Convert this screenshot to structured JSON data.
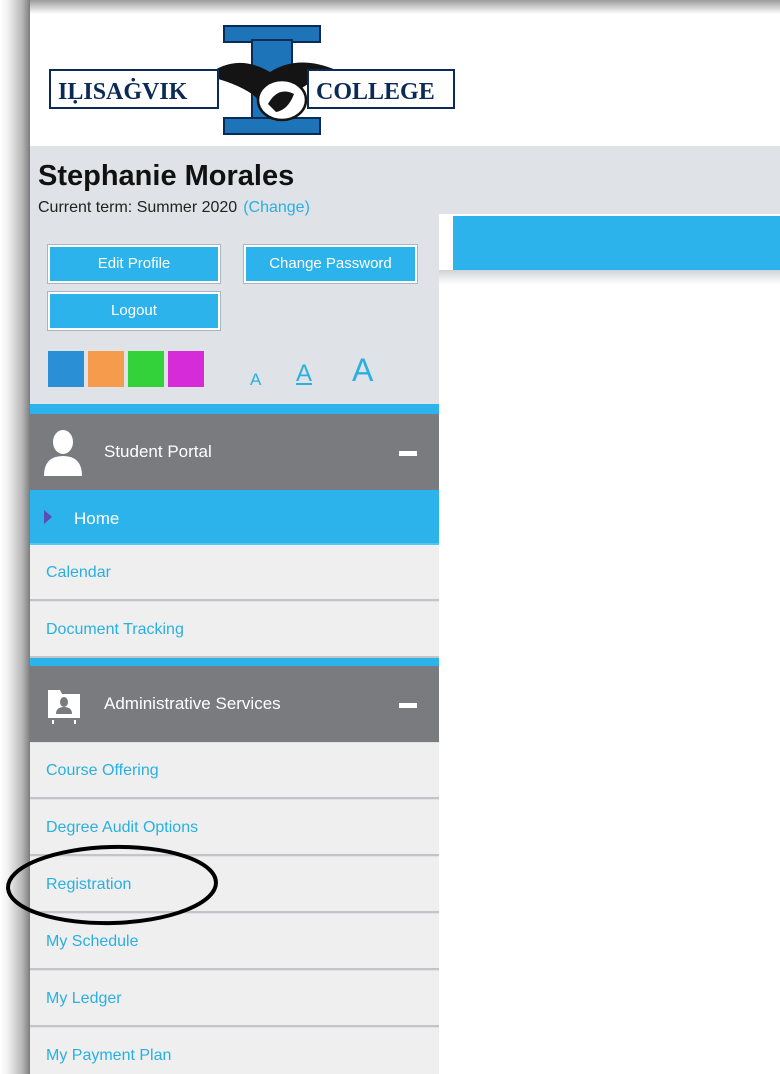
{
  "logo": {
    "left_text": "IḶISAĠVIK",
    "right_text": "COLLEGE"
  },
  "user": {
    "name": "Stephanie Morales",
    "term_label": "Current term: Summer 2020",
    "change_link": "(Change)"
  },
  "profile_buttons": {
    "edit_profile": "Edit Profile",
    "change_password": "Change Password",
    "logout": "Logout"
  },
  "theme_swatches": [
    "#2a8fd4",
    "#f69b4b",
    "#33d13a",
    "#d62bd8"
  ],
  "font_size_controls": {
    "small": "A",
    "medium": "A",
    "large": "A",
    "selected": "medium"
  },
  "colors": {
    "accent_blue": "#2db3ec",
    "link_blue": "#2ab0e0",
    "section_gray": "#797b7f",
    "annotation": "#000000"
  },
  "sections": [
    {
      "title": "Student Portal",
      "icon": "person-icon",
      "items": [
        "Home",
        "Calendar",
        "Document Tracking"
      ],
      "active_item": "Home"
    },
    {
      "title": "Administrative Services",
      "icon": "admin-services-icon",
      "items": [
        "Course Offering",
        "Degree Audit Options",
        "Registration",
        "My Schedule",
        "My Ledger",
        "My Payment Plan"
      ],
      "highlighted_item": "Registration"
    }
  ]
}
